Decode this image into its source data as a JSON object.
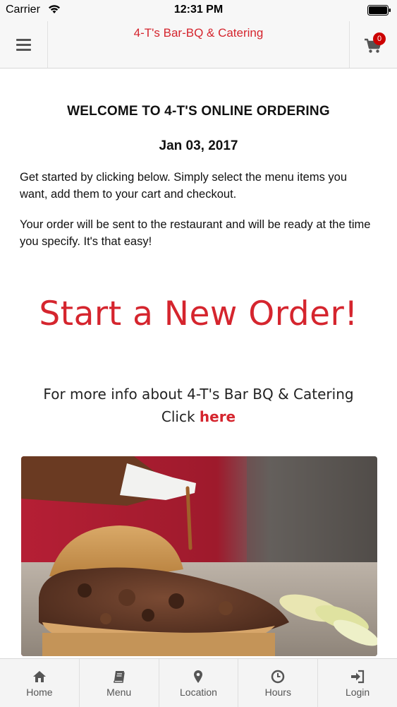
{
  "status_bar": {
    "carrier": "Carrier",
    "time": "12:31 PM"
  },
  "header": {
    "title": "4-T's Bar-BQ & Catering",
    "cart_count": "0"
  },
  "main": {
    "welcome": "WELCOME TO 4-T'S ONLINE ORDERING",
    "date": "Jan 03, 2017",
    "paragraph1": "Get started by clicking below. Simply select the menu items you want, add them to your cart and checkout.",
    "paragraph2": "Your order will be sent to the restaurant and will be ready at the time you specify. It's that easy!",
    "start_order": "Start a New Order!",
    "more_info_line1": "For more info about 4-T's Bar BQ & Catering",
    "more_info_click": "Click",
    "more_info_link": "here"
  },
  "tabs": [
    {
      "label": "Home",
      "icon": "home-icon"
    },
    {
      "label": "Menu",
      "icon": "book-icon"
    },
    {
      "label": "Location",
      "icon": "map-pin-icon"
    },
    {
      "label": "Hours",
      "icon": "clock-icon"
    },
    {
      "label": "Login",
      "icon": "login-icon"
    }
  ],
  "colors": {
    "accent": "#d5252e",
    "bar_background": "#f7f7f7",
    "badge": "#cc0000"
  }
}
